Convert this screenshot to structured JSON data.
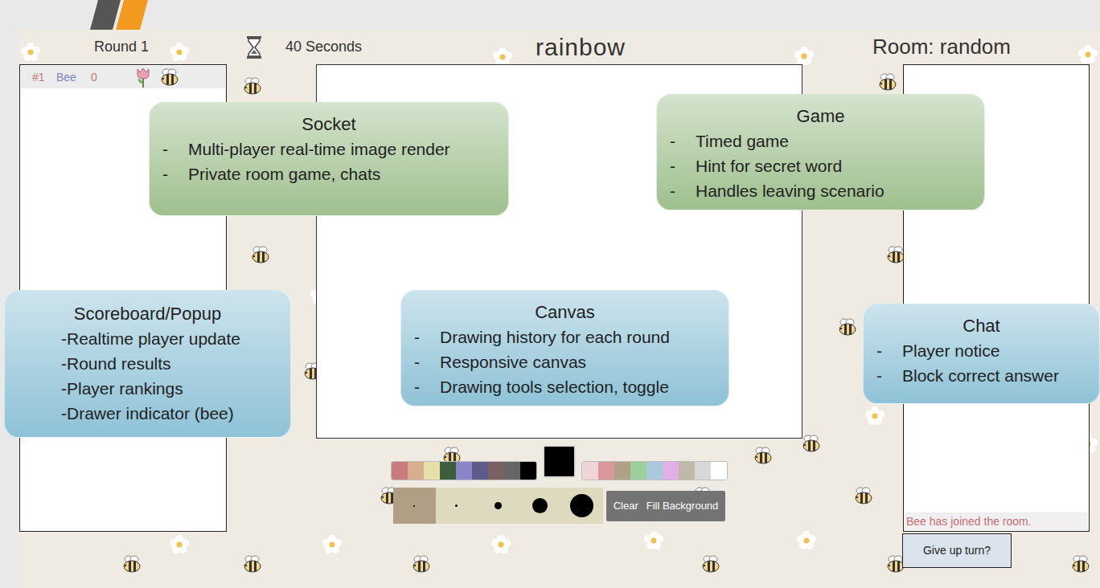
{
  "game": {
    "round": "Round 1",
    "timer": "40 Seconds",
    "word": "rainbow",
    "room": "Room: random"
  },
  "scoreboard": {
    "players": [
      {
        "rank": "#1",
        "name": "Bee",
        "score": "0",
        "drawing": true
      }
    ]
  },
  "palette": {
    "colors_left": [
      {
        "color": "#c97b7b"
      },
      {
        "color": "#d9ad8f"
      },
      {
        "color": "#e6e0a8"
      },
      {
        "color": "#3d5e3d"
      },
      {
        "color": "#8a86c9"
      },
      {
        "color": "#5e5a8a"
      },
      {
        "color": "#7a6060"
      },
      {
        "color": "#666666"
      },
      {
        "color": "#000000"
      }
    ],
    "current": "#000000",
    "colors_right": [
      {
        "color": "#f0d5d8"
      },
      {
        "color": "#d9979a"
      },
      {
        "color": "#b0a088"
      },
      {
        "color": "#9ccf9c"
      },
      {
        "color": "#a9c9dc"
      },
      {
        "color": "#e0b0e6"
      },
      {
        "color": "#c0b8a8"
      },
      {
        "color": "#d8d8d8"
      },
      {
        "color": "#ffffff"
      }
    ]
  },
  "brush_sizes": [
    {
      "selected": true
    },
    {
      "selected": false
    },
    {
      "selected": false
    },
    {
      "selected": false
    },
    {
      "selected": false
    }
  ],
  "tools": [
    "Clear",
    "Fill Background"
  ],
  "chat": {
    "messages": [
      "Bee has joined the room."
    ]
  },
  "give_up_button": "Give up turn?",
  "callouts": [
    {
      "title": "Socket",
      "bullet": "-",
      "items": [
        "Multi-player real-time image render",
        "Private room game, chats"
      ],
      "color": "#9fc08f"
    },
    {
      "title": "Game",
      "bullet": "-",
      "items": [
        "Timed game",
        "Hint for secret word",
        "Handles leaving scenario"
      ],
      "color": "#9fc08f"
    },
    {
      "title": "Scoreboard/Popup",
      "items": [
        "-Realtime player update",
        "-Round results",
        "-Player rankings",
        "-Drawer indicator (bee)"
      ],
      "color": "#8ec2d6"
    },
    {
      "title": "Canvas",
      "bullet": "-",
      "items": [
        "Drawing history for each round",
        "Responsive canvas",
        "Drawing tools selection, toggle"
      ],
      "color": "#8ec2d6"
    },
    {
      "title": "Chat",
      "bullet": "-",
      "items": [
        "Player notice",
        "Block correct answer"
      ],
      "color": "#8ec2d6"
    }
  ]
}
